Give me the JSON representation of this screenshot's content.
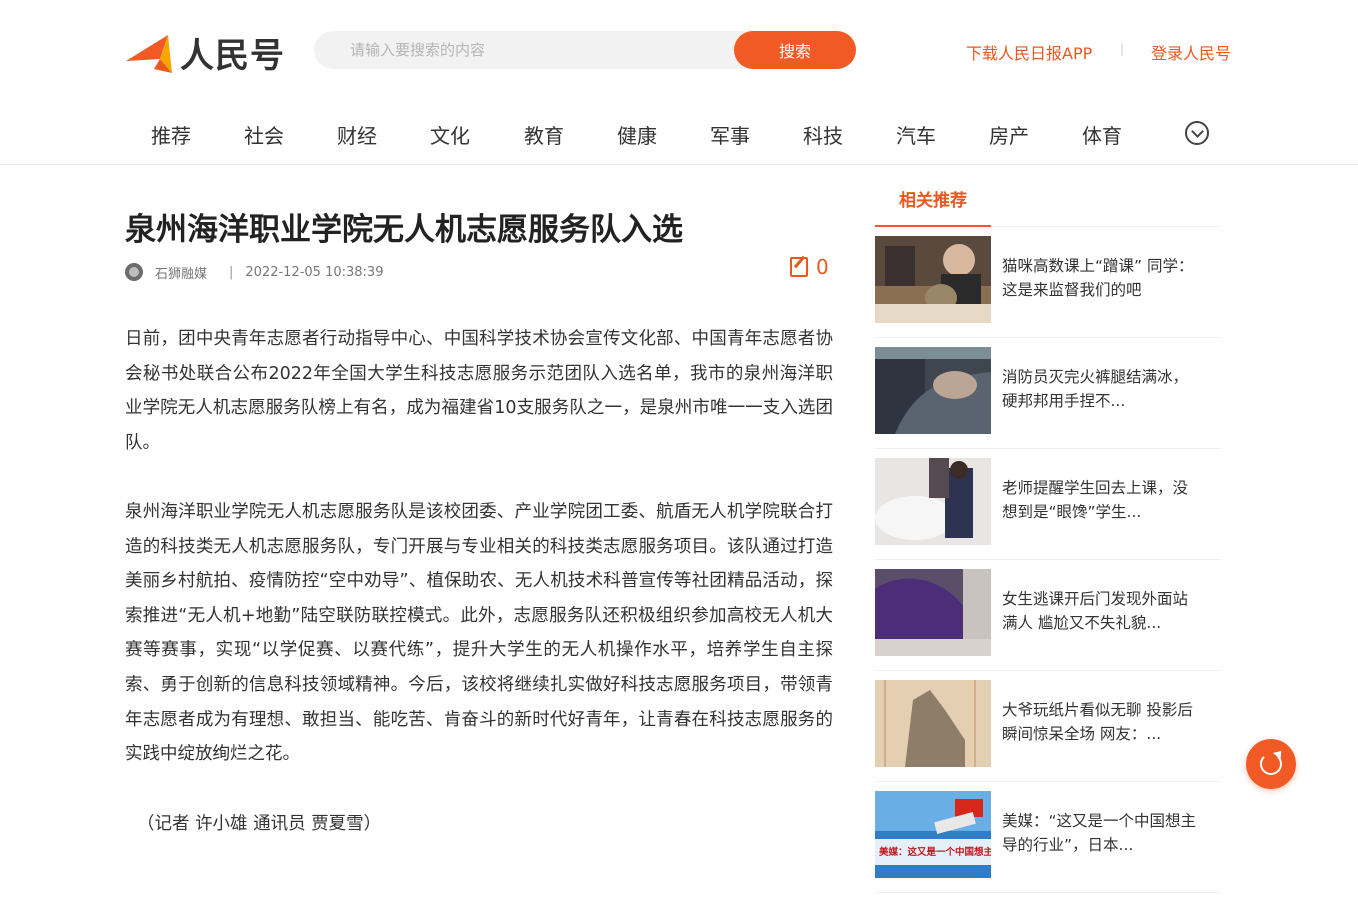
{
  "header": {
    "logo_text": "人民号",
    "search_placeholder": "请输入要搜索的内容",
    "search_button": "搜索",
    "download_link": "下载人民日报APP",
    "separator": "|",
    "login_link": "登录人民号"
  },
  "nav": {
    "items": [
      "推荐",
      "社会",
      "财经",
      "文化",
      "教育",
      "健康",
      "军事",
      "科技",
      "汽车",
      "房产",
      "体育"
    ],
    "more_icon": "chevron-down-circle-icon"
  },
  "article": {
    "title": "泉州海洋职业学院无人机志愿服务队入选",
    "source": "石狮融媒",
    "meta_separator": "|",
    "datetime": "2022-12-05 10:38:39",
    "comment_count": "0",
    "paragraphs": [
      "日前，团中央青年志愿者行动指导中心、中国科学技术协会宣传文化部、中国青年志愿者协会秘书处联合公布2022年全国大学生科技志愿服务示范团队入选名单，我市的泉州海洋职业学院无人机志愿服务队榜上有名，成为福建省10支服务队之一，是泉州市唯一一支入选团队。",
      "泉州海洋职业学院无人机志愿服务队是该校团委、产业学院团工委、航盾无人机学院联合打造的科技类无人机志愿服务队，专门开展与专业相关的科技类志愿服务项目。该队通过打造美丽乡村航拍、疫情防控“空中劝导”、植保助农、无人机技术科普宣传等社团精品活动，探索推进“无人机+地勤”陆空联防联控模式。此外，志愿服务队还积极组织参加高校无人机大赛等赛事，实现“以学促赛、以赛代练”，提升大学生的无人机操作水平，培养学生自主探索、勇于创新的信息科技领域精神。今后，该校将继续扎实做好科技志愿服务项目，带领青年志愿者成为有理想、敢担当、能吃苦、肯奋斗的新时代好青年，让青春在科技志愿服务的实践中绽放绚烂之花。",
      "（记者 许小雄 通讯员 贾夏雪）"
    ]
  },
  "sidebar": {
    "tab_label": "相关推荐",
    "items": [
      {
        "title": "猫咪高数课上“蹭课” 同学：这是来监督我们的吧"
      },
      {
        "title": "消防员灭完火裤腿结满冰，硬邦邦用手捏不..."
      },
      {
        "title": "老师提醒学生回去上课，没想到是“眼馋”学生..."
      },
      {
        "title": "女生逃课开后门发现外面站满人 尴尬又不失礼貌..."
      },
      {
        "title": "大爷玩纸片看似无聊 投影后瞬间惊呆全场 网友：..."
      },
      {
        "title": "美媒：“这又是一个中国想主导的行业”，日本..."
      }
    ],
    "thumb4_overlay": "美媒：这又是一个中国想主导的行业"
  },
  "colors": {
    "accent": "#f15a24",
    "link": "#e8591f"
  }
}
